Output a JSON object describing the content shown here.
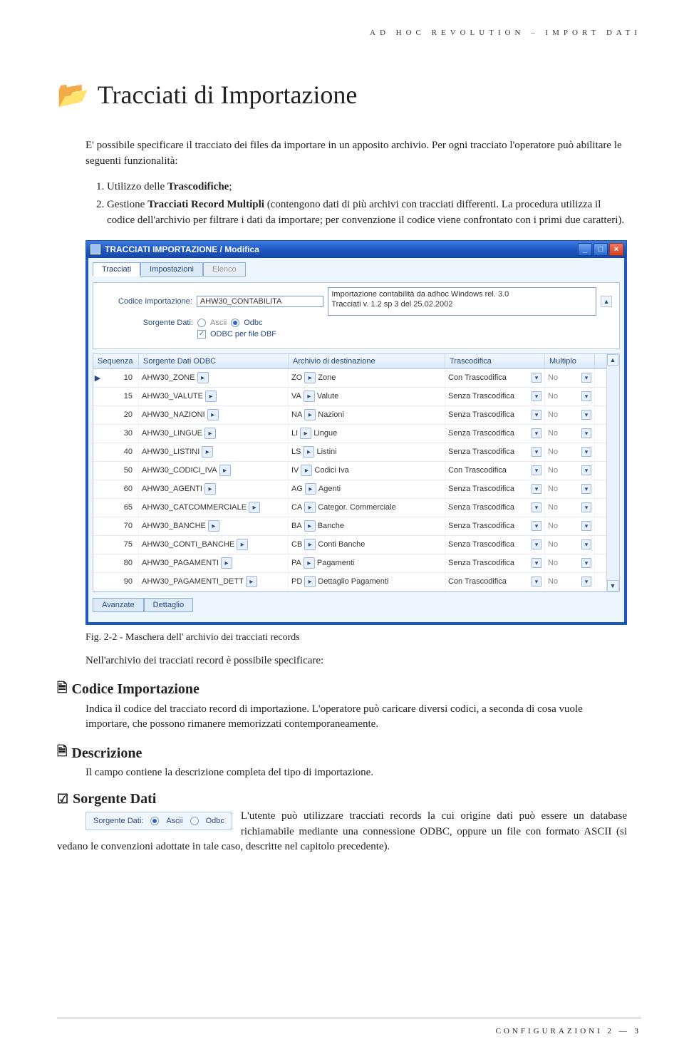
{
  "header": {
    "small_title": "AD HOC REVOLUTION – IMPORT DATI"
  },
  "chapter": {
    "icon": "📂",
    "title": "Tracciati di Importazione",
    "intro": "E' possibile specificare il tracciato dei files da importare in un apposito archivio. Per ogni tracciato l'operatore può abilitare le seguenti funzionalità:",
    "item1_pre": "Utilizzo delle ",
    "item1_b": "Trascodifiche",
    "item1_post": ";",
    "item2_pre": "Gestione ",
    "item2_b": "Tracciati Record Multipli",
    "item2_post": " (contengono dati di più archivi con tracciati differenti. La procedura utilizza il codice dell'archivio per filtrare i dati da importare; per convenzione il codice viene confrontato con i primi due caratteri)."
  },
  "win": {
    "title": "TRACCIATI IMPORTAZIONE / Modifica",
    "tabs": {
      "t1": "Tracciati",
      "t2": "Impostazioni",
      "t3": "Elenco"
    },
    "form": {
      "lbl_code": "Codice Importazione:",
      "code_value": "AHW30_CONTABILITA",
      "lbl_src": "Sorgente Dati:",
      "radio_ascii": "Ascii",
      "radio_odbc": "Odbc",
      "chk_dbf": "ODBC per file DBF",
      "desc_l1": "Importazione contabilità da adhoc Windows rel. 3.0",
      "desc_l2": "Tracciati v. 1.2 sp 3 del 25.02.2002"
    },
    "grid": {
      "h_seq": "Sequenza",
      "h_src": "Sorgente Dati ODBC",
      "h_dest": "Archivio di destinazione",
      "h_tras": "Trascodifica",
      "h_mul": "Multiplo",
      "rows": [
        {
          "seq": "10",
          "src": "AHW30_ZONE",
          "dcode": "ZO",
          "dname": "Zone",
          "tras": "Con Trascodifica",
          "mul": "No"
        },
        {
          "seq": "15",
          "src": "AHW30_VALUTE",
          "dcode": "VA",
          "dname": "Valute",
          "tras": "Senza Trascodifica",
          "mul": "No"
        },
        {
          "seq": "20",
          "src": "AHW30_NAZIONI",
          "dcode": "NA",
          "dname": "Nazioni",
          "tras": "Senza Trascodifica",
          "mul": "No"
        },
        {
          "seq": "30",
          "src": "AHW30_LINGUE",
          "dcode": "LI",
          "dname": "Lingue",
          "tras": "Senza Trascodifica",
          "mul": "No"
        },
        {
          "seq": "40",
          "src": "AHW30_LISTINI",
          "dcode": "LS",
          "dname": "Listini",
          "tras": "Senza Trascodifica",
          "mul": "No"
        },
        {
          "seq": "50",
          "src": "AHW30_CODICI_IVA",
          "dcode": "IV",
          "dname": "Codici Iva",
          "tras": "Con Trascodifica",
          "mul": "No"
        },
        {
          "seq": "60",
          "src": "AHW30_AGENTI",
          "dcode": "AG",
          "dname": "Agenti",
          "tras": "Senza Trascodifica",
          "mul": "No"
        },
        {
          "seq": "65",
          "src": "AHW30_CATCOMMERCIALE",
          "dcode": "CA",
          "dname": "Categor. Commerciale",
          "tras": "Senza Trascodifica",
          "mul": "No"
        },
        {
          "seq": "70",
          "src": "AHW30_BANCHE",
          "dcode": "BA",
          "dname": "Banche",
          "tras": "Senza Trascodifica",
          "mul": "No"
        },
        {
          "seq": "75",
          "src": "AHW30_CONTI_BANCHE",
          "dcode": "CB",
          "dname": "Conti Banche",
          "tras": "Senza Trascodifica",
          "mul": "No"
        },
        {
          "seq": "80",
          "src": "AHW30_PAGAMENTI",
          "dcode": "PA",
          "dname": "Pagamenti",
          "tras": "Senza Trascodifica",
          "mul": "No"
        },
        {
          "seq": "90",
          "src": "AHW30_PAGAMENTI_DETT",
          "dcode": "PD",
          "dname": "Dettaglio Pagamenti",
          "tras": "Con Trascodifica",
          "mul": "No"
        }
      ]
    },
    "bottom_tabs": {
      "b1": "Avanzate",
      "b2": "Dettaglio"
    }
  },
  "caption": "Fig. 2-2 - Maschera dell' archivio dei tracciati records",
  "post_caption": "Nell'archivio dei tracciati record è possibile specificare:",
  "sec_code": {
    "title": "Codice Importazione",
    "body": "Indica il codice del tracciato record di importazione. L'operatore può caricare diversi codici, a seconda di cosa vuole importare, che possono rimanere memorizzati contemporaneamente."
  },
  "sec_desc": {
    "title": "Descrizione",
    "body": "Il campo contiene la descrizione completa del tipo di importazione."
  },
  "sec_src": {
    "title": "Sorgente Dati",
    "inset_label": "Sorgente Dati:",
    "inset_ascii": "Ascii",
    "inset_odbc": "Odbc",
    "body": "L'utente può utilizzare tracciati records la cui origine dati può essere un database richiamabile mediante una connessione ODBC, oppure un file con formato ASCII (si vedano le convenzioni adottate in tale caso, descritte nel capitolo precedente)."
  },
  "footer": {
    "text": "CONFIGURAZIONI   2 — 3"
  }
}
